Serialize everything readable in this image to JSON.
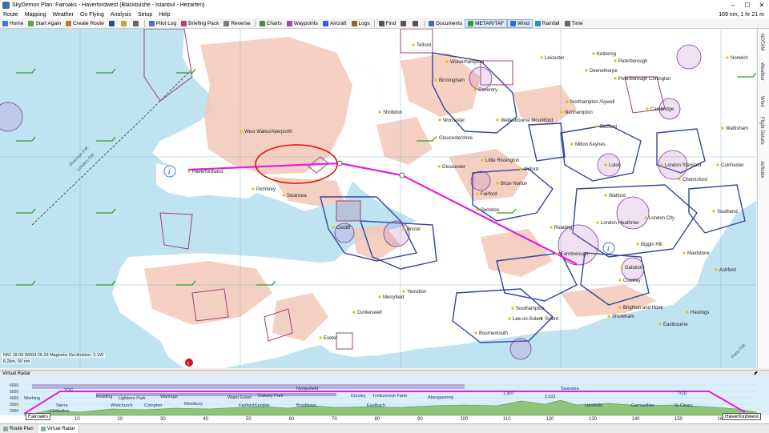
{
  "window": {
    "title": "SkyDemon Plan: Fairoaks - Haverfordwest (Blackbushe - Istanbul - Hezarfen)",
    "controls": [
      "–",
      "☐",
      "✕"
    ]
  },
  "menu": {
    "items": [
      "Route",
      "Mapping",
      "Weather",
      "Go Flying",
      "Analysis",
      "Setup",
      "Help"
    ],
    "summary": "169 nm, 1 hr 21 m"
  },
  "toolbar": {
    "items": [
      {
        "label": "Home",
        "icon": "home-icon",
        "color": "#3a7bd5"
      },
      {
        "label": "Start Again",
        "icon": "new-route-icon",
        "color": "#5aa34a"
      },
      {
        "label": "Create Route",
        "icon": "create-route-icon",
        "color": "#d0742a"
      },
      {
        "label": "",
        "icon": "save-icon",
        "color": "#2d4f88"
      },
      {
        "label": "",
        "icon": "open-icon",
        "color": "#c9a43a"
      },
      {
        "label": "",
        "icon": "undo-icon",
        "color": "#666666"
      },
      {
        "label": "Pilot Log",
        "icon": "pilot-log-icon",
        "color": "#4a77b0"
      },
      {
        "label": "Briefing Pack",
        "icon": "briefing-pack-icon",
        "color": "#b0476a"
      },
      {
        "label": "Reverse",
        "icon": "reverse-icon",
        "color": "#7a7a7a"
      },
      {
        "label": "Charts",
        "icon": "charts-icon",
        "color": "#4b8a4b"
      },
      {
        "label": "Waypoints",
        "icon": "waypoints-icon",
        "color": "#a04ab0"
      },
      {
        "label": "Aircraft",
        "icon": "aircraft-icon",
        "color": "#3b5bd0"
      },
      {
        "label": "Logs",
        "icon": "logs-icon",
        "color": "#8a6a2a"
      },
      {
        "label": "Find",
        "icon": "find-icon",
        "color": "#555555"
      },
      {
        "label": "",
        "icon": "zoom-in-icon",
        "color": "#555555"
      },
      {
        "label": "",
        "icon": "zoom-out-icon",
        "color": "#555555"
      },
      {
        "label": "Documents",
        "icon": "documents-icon",
        "color": "#4a6ab0"
      },
      {
        "label": "METAR/TAF",
        "icon": "metar-taf-icon",
        "color": "#2f9b3a",
        "checked": true
      },
      {
        "label": "Wind",
        "icon": "wind-icon",
        "color": "#2f6bd0",
        "checked": true
      },
      {
        "label": "Rainfall",
        "icon": "rainfall-icon",
        "color": "#2a8ad0"
      },
      {
        "label": "Time",
        "icon": "time-icon",
        "color": "#666666"
      }
    ]
  },
  "side_tabs": [
    "NOTAM",
    "Weather",
    "Wind",
    "Flight Details",
    "Airfields"
  ],
  "map": {
    "places": [
      "Telford",
      "Wolverhampton",
      "Leicester",
      "Kettering",
      "Peterborough",
      "Norwich",
      "Birmingham",
      "Coventry",
      "Deenethorpe",
      "Peterborough Conington",
      "Northampton /Sywell",
      "Northampton",
      "Cambridge",
      "Shobdon",
      "Worcester",
      "Wellesbourne Mountford",
      "Bedford",
      "Wattisham",
      "West Wales/Aberporth",
      "Gloucestershire",
      "Gloucester",
      "Milton Keynes",
      "Luton",
      "London Stansted",
      "Colchester",
      "Haverfordwest",
      "Little Rissington",
      "Oxford",
      "Brize Norton",
      "Fairford",
      "Watford",
      "Chelmsford",
      "Pembrey",
      "Swansea",
      "Bristol",
      "Swindon",
      "Cardiff",
      "Reading",
      "London Heathrow",
      "London City",
      "Southend",
      "Biggin Hill",
      "Farnborough",
      "Maidstone",
      "Ashford",
      "Gatwick",
      "Crawley",
      "Yeovilton",
      "Merryfield",
      "Dunkeswell",
      "Southampton",
      "Bournemouth",
      "Exeter",
      "Brighton and Hove",
      "Shoreham",
      "Eastbourne",
      "Hastings",
      "Solent",
      "Lee-on-Solent"
    ],
    "fir_labels": [
      "Shannon FIR",
      "London FIR",
      "Paris FIR"
    ],
    "info_line1": "N51 19.09  W003 26.23   Magnetic Declination: 2.1W",
    "info_line2": "6.2km, 50 nm"
  },
  "radar": {
    "title": "Virtual Radar",
    "pin": "🖈",
    "alt_labels": [
      "6000",
      "5000",
      "4000",
      "3000",
      "2000"
    ],
    "distance_ticks": [
      "10",
      "20",
      "30",
      "40",
      "50",
      "60",
      "70",
      "80",
      "90",
      "100",
      "110",
      "120",
      "130",
      "140",
      "150",
      "160"
    ],
    "start": "Fairoaks",
    "end": "Haverfordwest",
    "profile_labels": [
      "TOC",
      "Reading",
      "Wantage",
      "Membury",
      "Water Eaton",
      "Oaksey Park",
      "Nympsfield",
      "Dursley",
      "Tredunnock Farm",
      "Abergavenny",
      "Swansea",
      "TOD",
      "Sierra",
      "Whitchurch",
      "Compton",
      "Fairford",
      "Kemble",
      "Bowldown",
      "Eastbach",
      "Llandeilo",
      "Carmarthen",
      "St Clears",
      "Working",
      "Ugliterre Park",
      "Chilbolton"
    ],
    "elev_labels": [
      "1,907",
      "2,631"
    ]
  },
  "status_tabs": [
    {
      "label": "Route Plan",
      "active": false
    },
    {
      "label": "Virtual Radar",
      "active": true
    }
  ],
  "colors": {
    "sea": "#bfe3f1",
    "land": "#ffffff",
    "high_ground": "#f3c8b8",
    "route": "#e020e0",
    "airspace_blue": "#35459a",
    "airspace_purple": "#a0407a",
    "highlight_ellipse": "#e11010"
  }
}
